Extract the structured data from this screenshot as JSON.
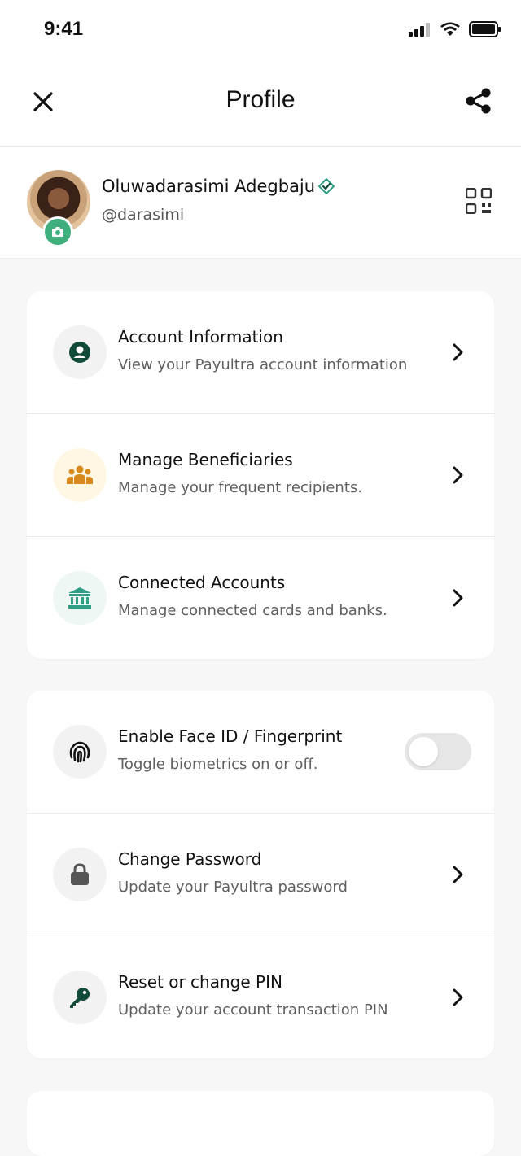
{
  "status": {
    "time": "9:41"
  },
  "header": {
    "title": "Profile"
  },
  "profile": {
    "name": "Oluwadarasimi Adegbaju",
    "handle": "@darasimi"
  },
  "colors": {
    "accent": "#3fb07d",
    "dark_green": "#124a3a",
    "orange": "#d8891c",
    "teal": "#2f9e84"
  },
  "sections": [
    {
      "items": [
        {
          "title": "Account Information",
          "subtitle": "View your Payultra account information",
          "icon": "user-circle-icon"
        },
        {
          "title": "Manage Beneficiaries",
          "subtitle": "Manage your frequent recipients.",
          "icon": "users-group-icon"
        },
        {
          "title": "Connected Accounts",
          "subtitle": "Manage connected cards and banks.",
          "icon": "bank-icon"
        }
      ]
    },
    {
      "items": [
        {
          "title": "Enable Face ID / Fingerprint",
          "subtitle": "Toggle biometrics on or off.",
          "icon": "fingerprint-icon",
          "toggle_on": false
        },
        {
          "title": "Change Password",
          "subtitle": "Update your Payultra password",
          "icon": "lock-icon"
        },
        {
          "title": "Reset or change PIN",
          "subtitle": "Update your account transaction PIN",
          "icon": "key-icon"
        }
      ]
    }
  ]
}
